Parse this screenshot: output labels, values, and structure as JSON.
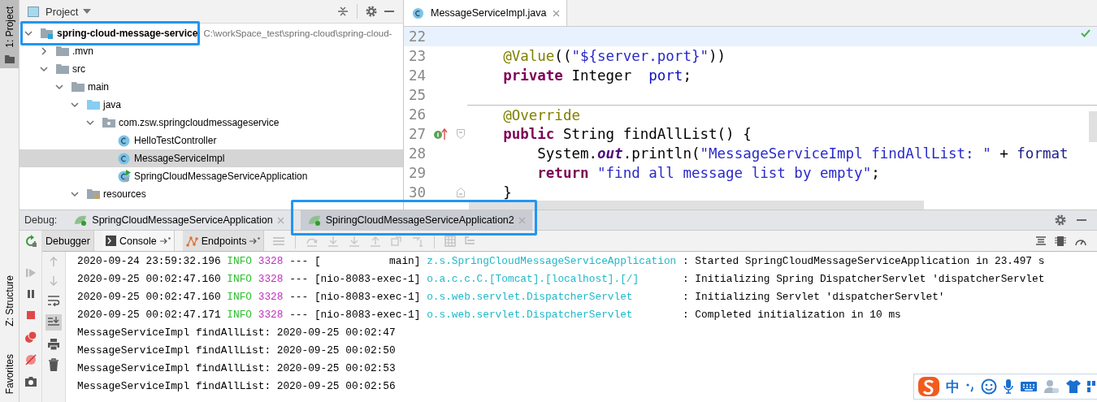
{
  "stripe": {
    "top_tabs": [
      {
        "label": "1: Project",
        "selected": true
      }
    ],
    "bottom_tabs": [
      {
        "label": "Z: Structure",
        "selected": false
      },
      {
        "label": "Favorites",
        "selected": false
      }
    ]
  },
  "project_panel": {
    "title": "Project",
    "tree": [
      {
        "name": "spring-cloud-message-service",
        "path": "C:\\workSpace_test\\spring-cloud\\spring-cloud-",
        "kind": "module",
        "expanded": true,
        "selected": false,
        "highlighted": true,
        "children": [
          {
            "name": ".mvn",
            "kind": "folder",
            "expanded": false,
            "selected": false
          },
          {
            "name": "src",
            "kind": "folder",
            "expanded": true,
            "selected": false,
            "children": [
              {
                "name": "main",
                "kind": "folder",
                "expanded": true,
                "selected": false,
                "children": [
                  {
                    "name": "java",
                    "kind": "source-folder",
                    "expanded": true,
                    "selected": false,
                    "children": [
                      {
                        "name": "com.zsw.springcloudmessageservice",
                        "kind": "package",
                        "expanded": true,
                        "selected": false,
                        "children": [
                          {
                            "name": "HelloTestController",
                            "kind": "class",
                            "selected": false
                          },
                          {
                            "name": "MessageServiceImpl",
                            "kind": "class",
                            "selected": true
                          },
                          {
                            "name": "SpringCloudMessageServiceApplication",
                            "kind": "app-class",
                            "selected": false
                          }
                        ]
                      }
                    ]
                  },
                  {
                    "name": "resources",
                    "kind": "resource-folder",
                    "expanded": true,
                    "selected": false
                  }
                ]
              }
            ]
          }
        ]
      }
    ]
  },
  "editor": {
    "tabs": [
      {
        "label": "MessageServiceImpl.java",
        "selected": true
      }
    ],
    "lines": [
      {
        "number": "22",
        "current": true,
        "implements_marker": false,
        "fold_start": false,
        "fold_end": false
      },
      {
        "number": "23",
        "current": false,
        "implements_marker": false,
        "fold_start": false,
        "fold_end": false,
        "kind": "member",
        "tokens": [
          {
            "kind": "annotation",
            "text": "@Value"
          },
          {
            "kind": "plain",
            "text": "(("
          },
          {
            "kind": "string",
            "text": "\"${server.port}\""
          },
          {
            "kind": "plain",
            "text": "))"
          }
        ]
      },
      {
        "number": "24",
        "current": false,
        "implements_marker": false,
        "fold_start": false,
        "fold_end": false,
        "kind": "member",
        "tokens": [
          {
            "kind": "keyword",
            "text": "private"
          },
          {
            "kind": "plain",
            "text": " Integer  "
          },
          {
            "kind": "field",
            "text": "port"
          },
          {
            "kind": "plain",
            "text": ";"
          }
        ]
      },
      {
        "number": "25",
        "current": false,
        "implements_marker": false,
        "fold_start": false,
        "fold_end": false
      },
      {
        "number": "26",
        "current": false,
        "implements_marker": false,
        "fold_start": false,
        "fold_end": false,
        "separator": true,
        "kind": "member",
        "tokens": [
          {
            "kind": "annotation",
            "text": "@Override"
          }
        ]
      },
      {
        "number": "27",
        "current": false,
        "implements_marker": true,
        "fold_start": true,
        "fold_end": false,
        "kind": "member",
        "tokens": [
          {
            "kind": "keyword",
            "text": "public"
          },
          {
            "kind": "plain",
            "text": " String findAllList() {"
          }
        ]
      },
      {
        "number": "28",
        "current": false,
        "implements_marker": false,
        "fold_start": false,
        "fold_end": false,
        "kind": "statement",
        "tokens": [
          {
            "kind": "plain",
            "text": "System."
          },
          {
            "kind": "static-field",
            "text": "out"
          },
          {
            "kind": "plain",
            "text": ".println("
          },
          {
            "kind": "string",
            "text": "\"MessageServiceImpl findAllList: \""
          },
          {
            "kind": "plain",
            "text": " + "
          },
          {
            "kind": "method",
            "text": "format"
          }
        ]
      },
      {
        "number": "29",
        "current": false,
        "implements_marker": false,
        "fold_start": false,
        "fold_end": false,
        "kind": "statement",
        "tokens": [
          {
            "kind": "keyword",
            "text": "return"
          },
          {
            "kind": "string",
            "text": " \"find all message list by empty\""
          },
          {
            "kind": "plain",
            "text": ";"
          }
        ]
      },
      {
        "number": "30",
        "current": false,
        "implements_marker": false,
        "fold_start": false,
        "fold_end": true,
        "kind": "member",
        "tokens": [
          {
            "kind": "plain",
            "text": "}"
          }
        ]
      }
    ]
  },
  "debug": {
    "label": "Debug:",
    "sessions": [
      {
        "label": "SpringCloudMessageServiceApplication",
        "selected": false,
        "highlighted": false
      },
      {
        "label": "SpiringCloudMessageServiceApplication2",
        "selected": true,
        "highlighted": true
      }
    ],
    "views": [
      {
        "label": "Debugger",
        "kind": "debugger",
        "selected": false
      },
      {
        "label": "Console",
        "kind": "console",
        "selected": true
      },
      {
        "label": "Endpoints",
        "kind": "endpoints",
        "selected": false
      }
    ],
    "console": [
      {
        "kind": "log",
        "timestamp": "2020-09-24 23:59:32.196",
        "level": "INFO",
        "pid": "3328",
        "dashes": "---",
        "thread": "[           main]",
        "logger": "z.s.SpringCloudMessageServiceApplication",
        "message": ": Started SpringCloudMessageServiceApplication in 23.497 s"
      },
      {
        "kind": "log",
        "timestamp": "2020-09-25 00:02:47.160",
        "level": "INFO",
        "pid": "3328",
        "dashes": "---",
        "thread": "[nio-8083-exec-1]",
        "logger": "o.a.c.c.C.[Tomcat].[localhost].[/]",
        "message": ": Initializing Spring DispatcherServlet 'dispatcherServlet"
      },
      {
        "kind": "log",
        "timestamp": "2020-09-25 00:02:47.160",
        "level": "INFO",
        "pid": "3328",
        "dashes": "---",
        "thread": "[nio-8083-exec-1]",
        "logger": "o.s.web.servlet.DispatcherServlet",
        "message": ": Initializing Servlet 'dispatcherServlet'"
      },
      {
        "kind": "log",
        "timestamp": "2020-09-25 00:02:47.171",
        "level": "INFO",
        "pid": "3328",
        "dashes": "---",
        "thread": "[nio-8083-exec-1]",
        "logger": "o.s.web.servlet.DispatcherServlet",
        "message": ": Completed initialization in 10 ms"
      },
      {
        "kind": "plain",
        "text": "MessageServiceImpl findAllList: 2020-09-25 00:02:47"
      },
      {
        "kind": "plain",
        "text": "MessageServiceImpl findAllList: 2020-09-25 00:02:50"
      },
      {
        "kind": "plain",
        "text": "MessageServiceImpl findAllList: 2020-09-25 00:02:53"
      },
      {
        "kind": "plain",
        "text": "MessageServiceImpl findAllList: 2020-09-25 00:02:56"
      }
    ]
  },
  "ime_toolbar": {
    "mode": "中"
  }
}
